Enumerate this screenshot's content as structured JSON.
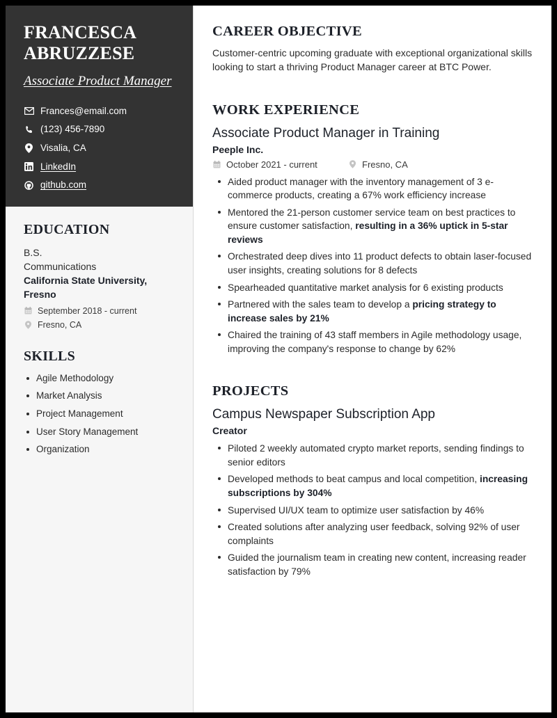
{
  "sidebar": {
    "name": "FRANCESCA ABRUZZESE",
    "job_title": "Associate Product Manager",
    "contacts": [
      {
        "icon": "envelope-icon",
        "label": "Frances@email.com",
        "is_link": false
      },
      {
        "icon": "phone-icon",
        "label": "(123) 456-7890",
        "is_link": false
      },
      {
        "icon": "location-pin-icon",
        "label": "Visalia, CA",
        "is_link": false
      },
      {
        "icon": "linkedin-icon",
        "label": "LinkedIn",
        "is_link": true
      },
      {
        "icon": "github-icon",
        "label": "github.com",
        "is_link": true
      }
    ],
    "education": {
      "heading": "EDUCATION",
      "degree_line1": "B.S.",
      "degree_line2": "Communications",
      "school": "California State University, Fresno",
      "date": "September 2018 - current",
      "location": "Fresno, CA"
    },
    "skills": {
      "heading": "SKILLS",
      "items": [
        "Agile Methodology",
        "Market Analysis",
        "Project Management",
        "User Story Management",
        "Organization"
      ]
    }
  },
  "main": {
    "objective": {
      "heading": "CAREER OBJECTIVE",
      "text": "Customer-centric upcoming graduate with exceptional organizational skills looking to start a thriving Product Manager career at BTC Power."
    },
    "work": {
      "heading": "WORK EXPERIENCE",
      "title": "Associate Product Manager in Training",
      "company": "Peeple Inc.",
      "date": "October 2021 - current",
      "location": "Fresno, CA",
      "bullets": [
        {
          "prefix": "Aided product manager with the inventory management of 3 e-commerce products, creating a 67% work efficiency increase",
          "bold": "",
          "suffix": ""
        },
        {
          "prefix": "Mentored the 21-person customer service team on best practices to ensure customer satisfaction, ",
          "bold": "resulting in a 36% uptick in 5-star reviews",
          "suffix": ""
        },
        {
          "prefix": "Orchestrated deep dives into 11 product defects to obtain laser-focused user insights, creating solutions for 8 defects",
          "bold": "",
          "suffix": ""
        },
        {
          "prefix": "Spearheaded quantitative market analysis for 6 existing products",
          "bold": "",
          "suffix": ""
        },
        {
          "prefix": "Partnered with the sales team to develop a ",
          "bold": "pricing strategy to increase sales by 21%",
          "suffix": ""
        },
        {
          "prefix": "Chaired the training of 43 staff members in Agile methodology usage, improving the company's response to change by 62%",
          "bold": "",
          "suffix": ""
        }
      ]
    },
    "projects": {
      "heading": "PROJECTS",
      "title": "Campus Newspaper Subscription App",
      "role": "Creator",
      "bullets": [
        {
          "prefix": "Piloted 2 weekly automated crypto market reports, sending findings to senior editors",
          "bold": "",
          "suffix": ""
        },
        {
          "prefix": "Developed methods to beat campus and local competition, ",
          "bold": "increasing subscriptions by 304%",
          "suffix": ""
        },
        {
          "prefix": "Supervised UI/UX team to optimize user satisfaction by 46%",
          "bold": "",
          "suffix": ""
        },
        {
          "prefix": "Created solutions after analyzing user feedback, solving 92% of user complaints",
          "bold": "",
          "suffix": ""
        },
        {
          "prefix": "Guided the journalism team in creating new content, increasing reader satisfaction by 79%",
          "bold": "",
          "suffix": ""
        }
      ]
    }
  },
  "colors": {
    "sidebar_header_bg": "#333333",
    "sidebar_bg": "#f6f6f6",
    "page_bg": "#ffffff",
    "frame": "#000000",
    "heading": "#1d2129",
    "body_text": "#2b2b2b"
  }
}
